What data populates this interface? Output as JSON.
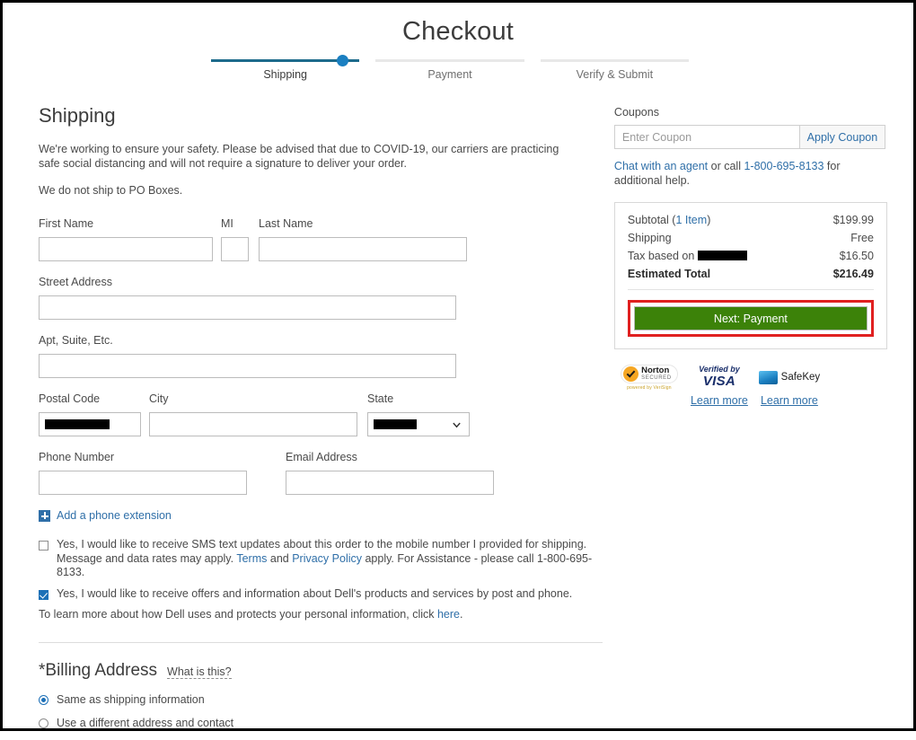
{
  "header": {
    "title": "Checkout",
    "steps": [
      {
        "label": "Shipping",
        "active": true
      },
      {
        "label": "Payment",
        "active": false
      },
      {
        "label": "Verify & Submit",
        "active": false
      }
    ]
  },
  "shipping": {
    "heading": "Shipping",
    "covid_notice": "We're working to ensure your safety. Please be advised that due to COVID-19, our carriers are practicing safe social distancing and will not require a signature to deliver your order.",
    "po_box_notice": "We do not ship to PO Boxes.",
    "fields": {
      "first_name_label": "First Name",
      "first_name_value": "",
      "mi_label": "MI",
      "mi_value": "",
      "last_name_label": "Last Name",
      "last_name_value": "",
      "street_label": "Street Address",
      "street_value": "",
      "apt_label": "Apt, Suite, Etc.",
      "apt_value": "",
      "postal_label": "Postal Code",
      "postal_value": "[redacted]",
      "city_label": "City",
      "city_value": "",
      "state_label": "State",
      "state_value": "[redacted]",
      "phone_label": "Phone Number",
      "phone_value": "",
      "email_label": "Email Address",
      "email_value": ""
    },
    "add_extension_label": "Add a phone extension",
    "sms_optin": {
      "checked": false,
      "text_1": "Yes, I would like to receive SMS text updates about this order to the mobile number I provided for shipping. Message and data rates may apply. ",
      "terms_link": "Terms",
      "text_2": " and ",
      "privacy_link": "Privacy Policy",
      "text_3": " apply. For Assistance - please call 1-800-695-8133."
    },
    "marketing_optin": {
      "checked": true,
      "text": "Yes, I would like to receive offers and information about Dell's products and services by post and phone."
    },
    "privacy_line": {
      "text_1": "To learn more about how Dell uses and protects your personal information, click ",
      "link": "here",
      "text_2": "."
    }
  },
  "billing": {
    "heading": "*Billing Address",
    "what_is_this": "What is this?",
    "options": [
      {
        "label": "Same as shipping information",
        "selected": true
      },
      {
        "label": "Use a different address and contact",
        "selected": false
      }
    ]
  },
  "coupons": {
    "label": "Coupons",
    "input_value": "",
    "input_placeholder": "Enter Coupon",
    "apply_label": "Apply Coupon",
    "help": {
      "chat_link": "Chat with an agent",
      "text_1": " or call ",
      "phone_link": "1-800-695-8133",
      "text_2": " for additional help."
    }
  },
  "summary": {
    "rows": [
      {
        "label_1": "Subtotal (",
        "label_link": "1 Item",
        "label_2": ")",
        "value": "$199.99",
        "bold": false
      },
      {
        "label_1": "Shipping",
        "label_link": "",
        "label_2": "",
        "value": "Free",
        "bold": false
      },
      {
        "label_1": "Tax based on ",
        "label_link": "",
        "label_2": "[redacted]",
        "value": "$16.50",
        "bold": false
      },
      {
        "label_1": "Estimated Total",
        "label_link": "",
        "label_2": "",
        "value": "$216.49",
        "bold": true
      }
    ],
    "subtotal_label": "Subtotal (",
    "subtotal_item_link": "1 Item",
    "subtotal_label_close": ")",
    "subtotal_value": "$199.99",
    "shipping_label": "Shipping",
    "shipping_value": "Free",
    "tax_label": "Tax based on",
    "tax_value": "$16.50",
    "total_label": "Estimated Total",
    "total_value": "$216.49",
    "next_button": "Next: Payment"
  },
  "badges": [
    {
      "name": "norton-secured",
      "title": "Norton",
      "subtitle": "SECURED",
      "powered": "powered by VeriSign",
      "learn_more": ""
    },
    {
      "name": "verified-by-visa",
      "line1": "Verified by",
      "line2": "VISA",
      "learn_more": "Learn more"
    },
    {
      "name": "safekey",
      "line1": "SafeKey",
      "learn_more": "Learn more"
    }
  ],
  "colors": {
    "accent_blue": "#2f6fa8",
    "step_active": "#1d6b8c",
    "step_dot": "#1a7fc1",
    "button_green": "#3c8209",
    "highlight_red": "#e02020",
    "checkbox_blue": "#1d70b7"
  }
}
